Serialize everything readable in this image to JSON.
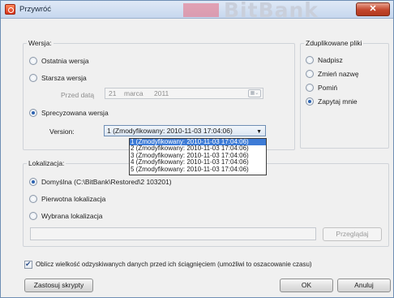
{
  "window": {
    "title": "Przywróć",
    "watermark": "BitBank",
    "close_glyph": "✕"
  },
  "version_group": {
    "label": "Wersja:",
    "latest_label": "Ostatnia wersja",
    "older_label": "Starsza wersja",
    "before_date_label": "Przed datą",
    "date": {
      "day": "21",
      "month": "marca",
      "year": "2011"
    },
    "specified_label": "Sprecyzowana wersja",
    "version_label": "Version:",
    "selected_version": "1 (Zmodyfikowany: 2010-11-03 17:04:06)",
    "options": [
      "1 (Zmodyfikowany: 2010-11-03 17:04:06)",
      "2 (Zmodyfikowany: 2010-11-03 17:04:06)",
      "3 (Zmodyfikowany: 2010-11-03 17:04:06)",
      "4 (Zmodyfikowany: 2010-11-03 17:04:06)",
      "5 (Zmodyfikowany: 2010-11-03 17:04:06)"
    ]
  },
  "duplicates_group": {
    "label": "Zduplikowane pliki",
    "options": [
      "Nadpisz",
      "Zmień nazwę",
      "Pomiń",
      "Zapytaj mnie"
    ]
  },
  "location_group": {
    "label": "Lokalizacja:",
    "default_label": "Domyślna (C:\\BitBank\\Restored\\2 103201)",
    "original_label": "Pierwotna lokalizacja",
    "chosen_label": "Wybrana lokalizacja",
    "browse_label": "Przeglądaj"
  },
  "estimate_label": "Oblicz wielkość odzyskiwanych danych przed ich ściągnięciem (umożliwi to oszacowanie czasu)",
  "buttons": {
    "scripts": "Zastosuj skrypty",
    "ok": "OK",
    "cancel": "Anuluj"
  },
  "colors": {
    "accent": "#3d7bd6",
    "title_bar": "#c6d7ee",
    "close": "#c3462c"
  }
}
